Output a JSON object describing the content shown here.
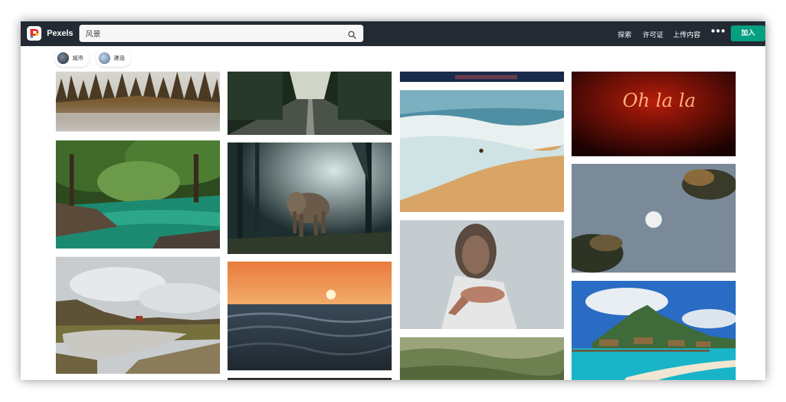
{
  "app": {
    "brand_name": "Pexels",
    "accent_color": "#05a081",
    "topbar_color": "#232a34"
  },
  "search": {
    "value": "风景",
    "icon": "search-icon"
  },
  "nav": {
    "explore": "探索",
    "license": "许可证",
    "upload": "上传内容",
    "more": "•••",
    "join": "加入"
  },
  "chips": [
    {
      "label": "城市"
    },
    {
      "label": "建造"
    }
  ],
  "photos": {
    "neon_text": "Oh la la"
  }
}
